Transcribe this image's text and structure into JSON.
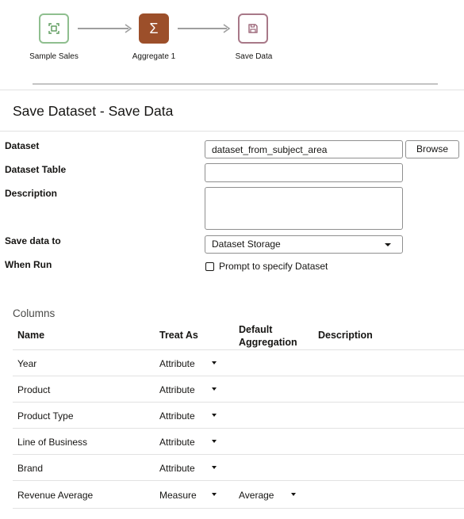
{
  "flow": {
    "nodes": [
      {
        "label": "Sample Sales",
        "icon": "dataset-source-icon"
      },
      {
        "label": "Aggregate 1",
        "icon": "sigma-icon",
        "glyph": "Σ"
      },
      {
        "label": "Save Data",
        "icon": "save-disk-icon"
      }
    ]
  },
  "panel": {
    "title": "Save Dataset - Save Data"
  },
  "form": {
    "dataset_label": "Dataset",
    "dataset_value": "dataset_from_subject_area",
    "browse_label": "Browse",
    "dataset_table_label": "Dataset Table",
    "dataset_table_value": "",
    "description_label": "Description",
    "description_value": "",
    "save_to_label": "Save data to",
    "save_to_value": "Dataset Storage",
    "when_run_label": "When Run",
    "prompt_label": "Prompt to specify Dataset",
    "prompt_checked": false
  },
  "columns": {
    "title": "Columns",
    "headers": {
      "name": "Name",
      "treat_as": "Treat As",
      "default_aggregation": "Default Aggregation",
      "description": "Description"
    },
    "rows": [
      {
        "name": "Year",
        "treat_as": "Attribute",
        "aggregation": ""
      },
      {
        "name": "Product",
        "treat_as": "Attribute",
        "aggregation": ""
      },
      {
        "name": "Product Type",
        "treat_as": "Attribute",
        "aggregation": ""
      },
      {
        "name": "Line of Business",
        "treat_as": "Attribute",
        "aggregation": ""
      },
      {
        "name": "Brand",
        "treat_as": "Attribute",
        "aggregation": ""
      },
      {
        "name": "Revenue Average",
        "treat_as": "Measure",
        "aggregation": "Average"
      }
    ]
  },
  "colors": {
    "source_node": "#8fbf8f",
    "aggregate_node": "#9c4f2a",
    "save_node": "#a87888"
  }
}
